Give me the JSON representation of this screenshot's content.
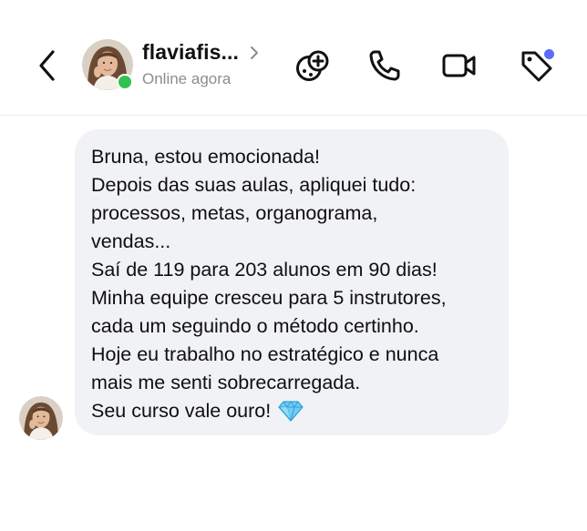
{
  "header": {
    "name": "flaviafis...",
    "status": "Online agora"
  },
  "icons": {
    "back": "chevron-left-icon",
    "games": "game-controller-icon",
    "call": "phone-icon",
    "video": "video-camera-icon",
    "tag": "tag-icon"
  },
  "colors": {
    "online": "#31c24d",
    "tag_dot": "#5b6cf9",
    "bubble": "#f1f2f6",
    "gem": "#4ab8f0"
  },
  "message": {
    "lines": [
      "Bruna, estou emocionada!",
      "Depois das suas aulas, apliquei tudo:",
      "processos, metas, organograma,",
      "vendas...",
      "Saí de 119 para 203 alunos em 90 dias!",
      "Minha equipe cresceu para 5 instrutores,",
      "cada um seguindo o método certinho.",
      "Hoje eu trabalho no estratégico e nunca",
      "mais me senti sobrecarregada.",
      "Seu curso vale ouro!"
    ],
    "emoji": "gem-emoji"
  }
}
